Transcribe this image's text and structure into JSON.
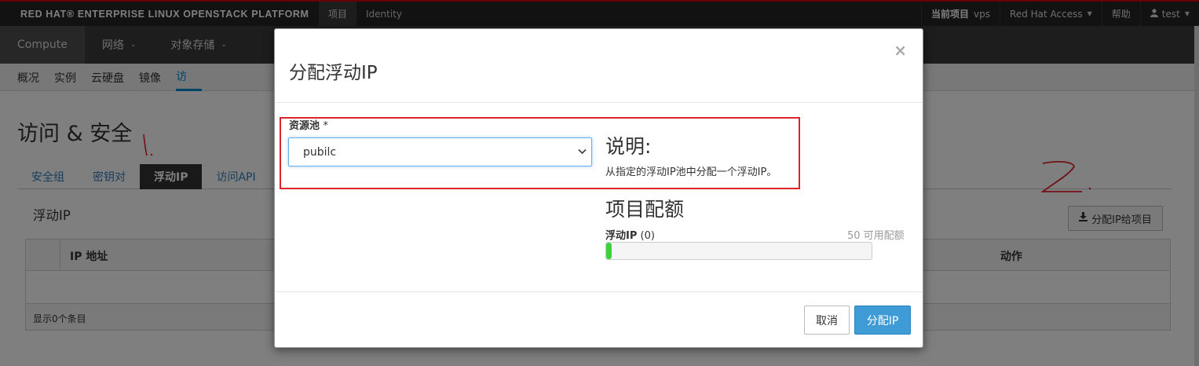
{
  "topbar": {
    "brand": "RED HAT® ENTERPRISE LINUX OPENSTACK PLATFORM",
    "tabs": [
      "项目",
      "Identity"
    ],
    "current_project_label": "当前项目",
    "current_project_value": "vps",
    "redhat_access": "Red Hat Access",
    "help": "帮助",
    "user": "test"
  },
  "nav": {
    "primary": [
      "Compute",
      "网络",
      "对象存储"
    ],
    "secondary": [
      "概况",
      "实例",
      "云硬盘",
      "镜像",
      "访"
    ]
  },
  "page": {
    "title": "访问 & 安全",
    "tabs": [
      "安全组",
      "密钥对",
      "浮动IP",
      "访问API"
    ],
    "section_title": "浮动IP",
    "allocate_button": "分配IP给项目",
    "table": {
      "columns": [
        "IP 地址",
        "动作"
      ],
      "footer": "显示0个条目"
    }
  },
  "modal": {
    "title": "分配浮动IP",
    "close": "×",
    "pool_label": "资源池",
    "required_mark": "*",
    "pool_value": "pubilc",
    "desc_heading": "说明:",
    "desc_text": "从指定的浮动IP池中分配一个浮动IP。",
    "quota_heading": "项目配额",
    "quota_name": "浮动IP",
    "quota_used": "(0)",
    "quota_available": "50 可用配额",
    "quota_fraction": 0.0,
    "cancel": "取消",
    "submit": "分配IP"
  },
  "colors": {
    "accent": "#0088ce",
    "primary_button": "#3f9bd6",
    "progress": "#3dd13d",
    "annotation": "#d9262b"
  }
}
